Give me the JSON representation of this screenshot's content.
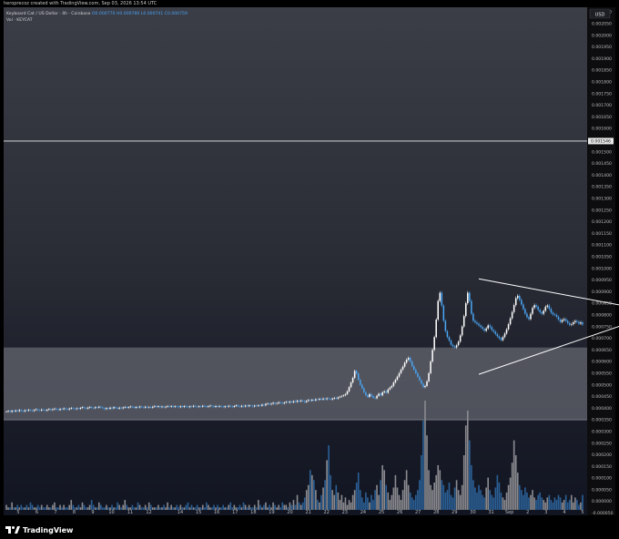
{
  "header": {
    "credit": "heroprecoz created with TradingView.com, Sep 03, 2026 13:54 UTC"
  },
  "legend": {
    "symbol": "Keyboard Cat / US Dollar · 4h · Coinbase",
    "open": "O0.000770",
    "high": "H0.000780",
    "low": "L0.000741",
    "close": "C0.000759",
    "volume_label": "Vol · KEYCAT"
  },
  "currency_button": "USD",
  "footer": {
    "brand": "TradingView"
  },
  "colors": {
    "up_candle": "#ffffff",
    "down_candle": "#4aa3f0",
    "volume_up": "#8a8a8f",
    "volume_down": "#2b5f95",
    "zone": "#7b7e86",
    "trendline": "#ffffff"
  },
  "chart_data": {
    "type": "candlestick",
    "x_ticks": [
      "5",
      "6",
      "7",
      "8",
      "9",
      "10",
      "11",
      "12",
      "14",
      "15",
      "16",
      "17",
      "18",
      "19",
      "20",
      "21",
      "22",
      "23",
      "24",
      "25",
      "26",
      "27",
      "28",
      "29",
      "30",
      "31",
      "Sep",
      "2",
      "3",
      "4",
      "5"
    ],
    "y_ticks": [
      "0.002100",
      "0.002050",
      "0.002000",
      "0.001950",
      "0.001900",
      "0.001850",
      "0.001800",
      "0.001750",
      "0.001700",
      "0.001650",
      "0.001600",
      "0.001550",
      "0.001500",
      "0.001450",
      "0.001400",
      "0.001350",
      "0.001300",
      "0.001250",
      "0.001200",
      "0.001150",
      "0.001100",
      "0.001050",
      "0.001000",
      "0.000950",
      "0.000900",
      "0.000850",
      "0.000800",
      "0.000750",
      "0.000700",
      "0.000650",
      "0.000600",
      "0.000550",
      "0.000500",
      "0.000450",
      "0.000400",
      "0.000350",
      "0.000300",
      "0.000250",
      "0.000200",
      "0.000150",
      "0.000100",
      "0.000050",
      "0.000000",
      "-0.000050"
    ],
    "ylim": [
      -6e-05,
      0.00212
    ],
    "horizontal_line": {
      "price": 0.001546,
      "label": "0.001546"
    },
    "zone": {
      "low": 0.00035,
      "high": 0.00066
    },
    "closes": [
      0.000385,
      0.000388,
      0.000384,
      0.000389,
      0.000386,
      0.00039,
      0.000387,
      0.000392,
      0.000388,
      0.000386,
      0.000391,
      0.000389,
      0.000393,
      0.00039,
      0.000388,
      0.000392,
      0.000395,
      0.000391,
      0.00039,
      0.000394,
      0.000392,
      0.000389,
      0.000393,
      0.000396,
      0.000392,
      0.000395,
      0.000398,
      0.000394,
      0.000392,
      0.000397,
      0.000395,
      0.000399,
      0.000396,
      0.000394,
      0.000398,
      0.000401,
      0.000398,
      0.000396,
      0.000399,
      0.000397,
      0.000401,
      0.000404,
      0.0004,
      0.000398,
      0.000402,
      0.000405,
      0.000401,
      0.0004,
      0.000404,
      0.000402,
      0.000406,
      0.000403,
      0.0004,
      0.000396,
      0.0004,
      0.000397,
      0.000402,
      0.000399,
      0.000404,
      0.000401,
      0.000398,
      0.000402,
      0.000399,
      0.000403,
      0.000405,
      0.000401,
      0.000404,
      0.000407,
      0.000404,
      0.000401,
      0.000405,
      0.000403,
      0.000407,
      0.000404,
      0.000402,
      0.000406,
      0.000403,
      0.000405,
      0.000402,
      0.000406,
      0.000409,
      0.000405,
      0.000408,
      0.000404,
      0.000407,
      0.000403,
      0.000406,
      0.000409,
      0.000406,
      0.000409,
      0.000405,
      0.000408,
      0.000407,
      0.000404,
      0.000408,
      0.000405,
      0.000409,
      0.000406,
      0.000404,
      0.000408,
      0.000406,
      0.00041,
      0.000407,
      0.000405,
      0.000408,
      0.000406,
      0.00041,
      0.000408,
      0.000405,
      0.000408,
      0.000411,
      0.000408,
      0.000405,
      0.000409,
      0.000406,
      0.000409,
      0.000407,
      0.000404,
      0.000408,
      0.000406,
      0.00041,
      0.000408,
      0.000405,
      0.000409,
      0.000412,
      0.000408,
      0.000406,
      0.00041,
      0.000407,
      0.000411,
      0.000408,
      0.000412,
      0.00041,
      0.000407,
      0.000411,
      0.000409,
      0.000412,
      0.00041,
      0.000415,
      0.000412,
      0.000418,
      0.00042,
      0.000416,
      0.000419,
      0.000423,
      0.000419,
      0.000421,
      0.000425,
      0.000422,
      0.00042,
      0.000424,
      0.000427,
      0.000424,
      0.000428,
      0.000425,
      0.00043,
      0.000427,
      0.000432,
      0.000429,
      0.000433,
      0.00043,
      0.000426,
      0.000431,
      0.000435,
      0.000432,
      0.000436,
      0.000433,
      0.000438,
      0.000436,
      0.00044,
      0.000437,
      0.000441,
      0.000438,
      0.000442,
      0.00044,
      0.000437,
      0.000441,
      0.000444,
      0.000441,
      0.000446,
      0.000449,
      0.000452,
      0.000455,
      0.00046,
      0.000472,
      0.00049,
      0.00051,
      0.00053,
      0.00056,
      0.000548,
      0.000522,
      0.0005,
      0.000485,
      0.000468,
      0.000455,
      0.000448,
      0.00046,
      0.000452,
      0.000445,
      0.000442,
      0.000453,
      0.000462,
      0.000455,
      0.000468,
      0.000472,
      0.000466,
      0.00048,
      0.000488,
      0.000495,
      0.00051,
      0.000522,
      0.000535,
      0.00055,
      0.000565,
      0.000578,
      0.000595,
      0.000608,
      0.000616,
      0.0006,
      0.00058,
      0.000565,
      0.00055,
      0.000535,
      0.00052,
      0.000505,
      0.00049,
      0.000495,
      0.000515,
      0.00055,
      0.0006,
      0.00065,
      0.000705,
      0.00078,
      0.00086,
      0.000895,
      0.00084,
      0.000775,
      0.00073,
      0.000705,
      0.00069,
      0.000672,
      0.000665,
      0.00066,
      0.00067,
      0.000685,
      0.000712,
      0.00075,
      0.000795,
      0.00085,
      0.000895,
      0.00086,
      0.000805,
      0.000775,
      0.000768,
      0.000762,
      0.000755,
      0.000748,
      0.00074,
      0.000732,
      0.000742,
      0.000755,
      0.000748,
      0.000735,
      0.000728,
      0.000718,
      0.000708,
      0.0007,
      0.000692,
      0.000705,
      0.00072,
      0.000738,
      0.00076,
      0.000785,
      0.000812,
      0.000842,
      0.000872,
      0.000882,
      0.000865,
      0.000845,
      0.000825,
      0.000805,
      0.00079,
      0.000782,
      0.000805,
      0.00083,
      0.000842,
      0.000835,
      0.000822,
      0.000812,
      0.000805,
      0.000818,
      0.000835,
      0.00084,
      0.000826,
      0.00081,
      0.000802,
      0.0008,
      0.000792,
      0.00078,
      0.00077,
      0.000778,
      0.000782,
      0.000774,
      0.000765,
      0.000758,
      0.00076,
      0.000768,
      0.000774,
      0.00077,
      0.000763,
      0.000768,
      0.000759
    ],
    "volumes": [
      2,
      1,
      1,
      3,
      1,
      1,
      2,
      1,
      2,
      1,
      1,
      2,
      1,
      3,
      2,
      1,
      1,
      2,
      1,
      2,
      1,
      1,
      2,
      1,
      1,
      2,
      3,
      1,
      1,
      2,
      1,
      2,
      1,
      1,
      2,
      4,
      2,
      1,
      1,
      2,
      1,
      3,
      2,
      1,
      1,
      2,
      4,
      2,
      1,
      1,
      3,
      2,
      1,
      1,
      2,
      1,
      1,
      2,
      1,
      1,
      3,
      2,
      1,
      2,
      4,
      2,
      1,
      1,
      2,
      1,
      1,
      3,
      2,
      1,
      1,
      2,
      1,
      3,
      2,
      1,
      1,
      1,
      2,
      1,
      1,
      2,
      1,
      3,
      1,
      2,
      1,
      1,
      2,
      1,
      2,
      1,
      1,
      2,
      3,
      1,
      2,
      1,
      1,
      2,
      1,
      1,
      2,
      1,
      3,
      2,
      1,
      1,
      2,
      1,
      2,
      1,
      1,
      2,
      1,
      1,
      2,
      3,
      1,
      2,
      1,
      1,
      2,
      1,
      3,
      2,
      1,
      2,
      1,
      1,
      2,
      1,
      4,
      2,
      1,
      2,
      3,
      1,
      2,
      1,
      3,
      2,
      1,
      2,
      1,
      3,
      2,
      2,
      1,
      3,
      2,
      4,
      2,
      6,
      3,
      2,
      3,
      5,
      8,
      10,
      16,
      14,
      12,
      8,
      4,
      3,
      6,
      9,
      12,
      20,
      26,
      14,
      8,
      6,
      10,
      7,
      4,
      6,
      3,
      5,
      2,
      4,
      3,
      6,
      8,
      11,
      15,
      8,
      5,
      3,
      7,
      5,
      3,
      6,
      4,
      8,
      10,
      6,
      12,
      18,
      16,
      10,
      7,
      4,
      6,
      9,
      14,
      9,
      6,
      4,
      8,
      12,
      16,
      10,
      7,
      5,
      4,
      6,
      8,
      12,
      22,
      36,
      44,
      30,
      16,
      10,
      8,
      11,
      14,
      18,
      16,
      12,
      10,
      7,
      8,
      11,
      6,
      5,
      9,
      12,
      8,
      6,
      10,
      22,
      34,
      40,
      28,
      18,
      12,
      9,
      7,
      10,
      8,
      6,
      5,
      9,
      13,
      8,
      6,
      5,
      9,
      14,
      11,
      7,
      5,
      4,
      7,
      10,
      13,
      19,
      28,
      22,
      15,
      10,
      8,
      6,
      9,
      7,
      5,
      6,
      8,
      5,
      4,
      6,
      7,
      5,
      4,
      3,
      5,
      6,
      4,
      3,
      5,
      4,
      6,
      5,
      3,
      4,
      6,
      3,
      4,
      6,
      3,
      5,
      4,
      2,
      3,
      6
    ],
    "vol_max": 44,
    "trendlines": [
      {
        "from": [
          255,
          0.000955
        ],
        "to": [
          331,
          0.000835
        ]
      },
      {
        "from": [
          255,
          0.000545
        ],
        "to": [
          331,
          0.000765
        ]
      }
    ]
  }
}
